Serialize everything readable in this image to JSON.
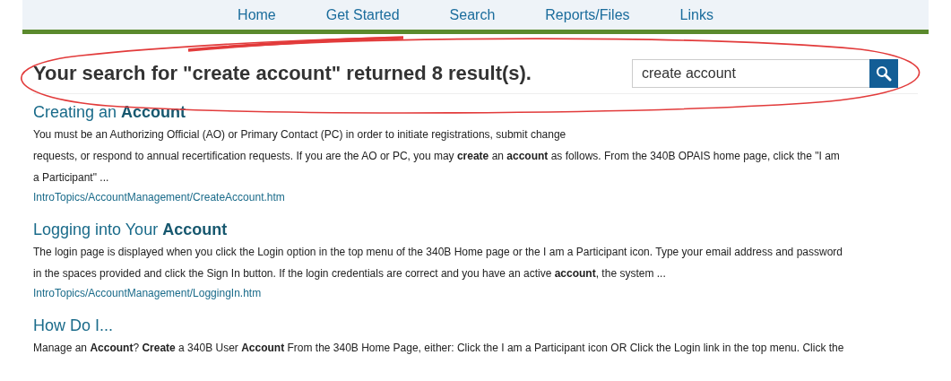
{
  "nav": {
    "items": [
      {
        "label": "Home"
      },
      {
        "label": "Get Started"
      },
      {
        "label": "Search"
      },
      {
        "label": "Reports/Files"
      },
      {
        "label": "Links"
      }
    ]
  },
  "search": {
    "heading": "Your search for \"create account\" returned 8 result(s).",
    "value": "create account"
  },
  "results": [
    {
      "title": "Creating an **Account**",
      "lines": [
        "You must be an Authorizing Official (AO) or Primary Contact (PC) in order to initiate registrations, submit change",
        "requests, or respond to annual recertification requests. If you are the AO or PC, you may **create** an **account** as follows. From the 340B OPAIS home page, click the \"I am",
        "a Participant\" ..."
      ],
      "path": "IntroTopics/AccountManagement/CreateAccount.htm"
    },
    {
      "title": "Logging into Your **Account**",
      "lines": [
        "The login page is displayed when you click the Login option in the top menu of the 340B Home page or the I am a Participant icon. Type your email address and password",
        "in the spaces provided and click the Sign In button. If the login credentials are correct and you have an active **account**, the system ..."
      ],
      "path": "IntroTopics/AccountManagement/LoggingIn.htm"
    },
    {
      "title": "How Do I...",
      "lines": [
        "Manage an **Account**? **Create** a 340B User **Account** From the 340B Home Page, either: Click the I am a Participant icon OR Click the Login link in the top menu. Click the"
      ]
    }
  ]
}
